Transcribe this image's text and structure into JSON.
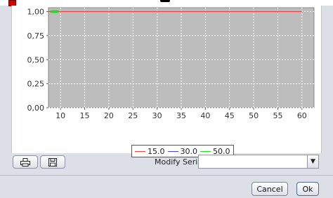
{
  "chart_data": {
    "type": "line",
    "x_ticks": [
      10,
      15,
      20,
      25,
      30,
      35,
      40,
      45,
      50,
      55,
      60
    ],
    "y_ticks": [
      "0,00",
      "0,25",
      "0,50",
      "0,75",
      "1,00"
    ],
    "xlim": [
      7.5,
      62.5
    ],
    "ylim": [
      0,
      1.04
    ],
    "grid": true,
    "legend_position": "bottom-center",
    "series": [
      {
        "name": "15.0",
        "color": "#ee4444",
        "x": [
          7.5,
          60
        ],
        "y": [
          1.0,
          1.0
        ]
      },
      {
        "name": "30.0",
        "color": "#4444ee",
        "x": [
          8,
          9.5
        ],
        "y": [
          1.0,
          1.0
        ]
      },
      {
        "name": "50.0",
        "color": "#22dd22",
        "x": [
          8,
          9.5
        ],
        "y": [
          1.0,
          1.0
        ]
      }
    ]
  },
  "controls": {
    "modify_label": "Modify Serie",
    "modify_value": "",
    "print_icon": "printer-icon",
    "save_icon": "floppy-disk-icon",
    "cancel_label": "Cancel",
    "ok_label": "Ok"
  }
}
